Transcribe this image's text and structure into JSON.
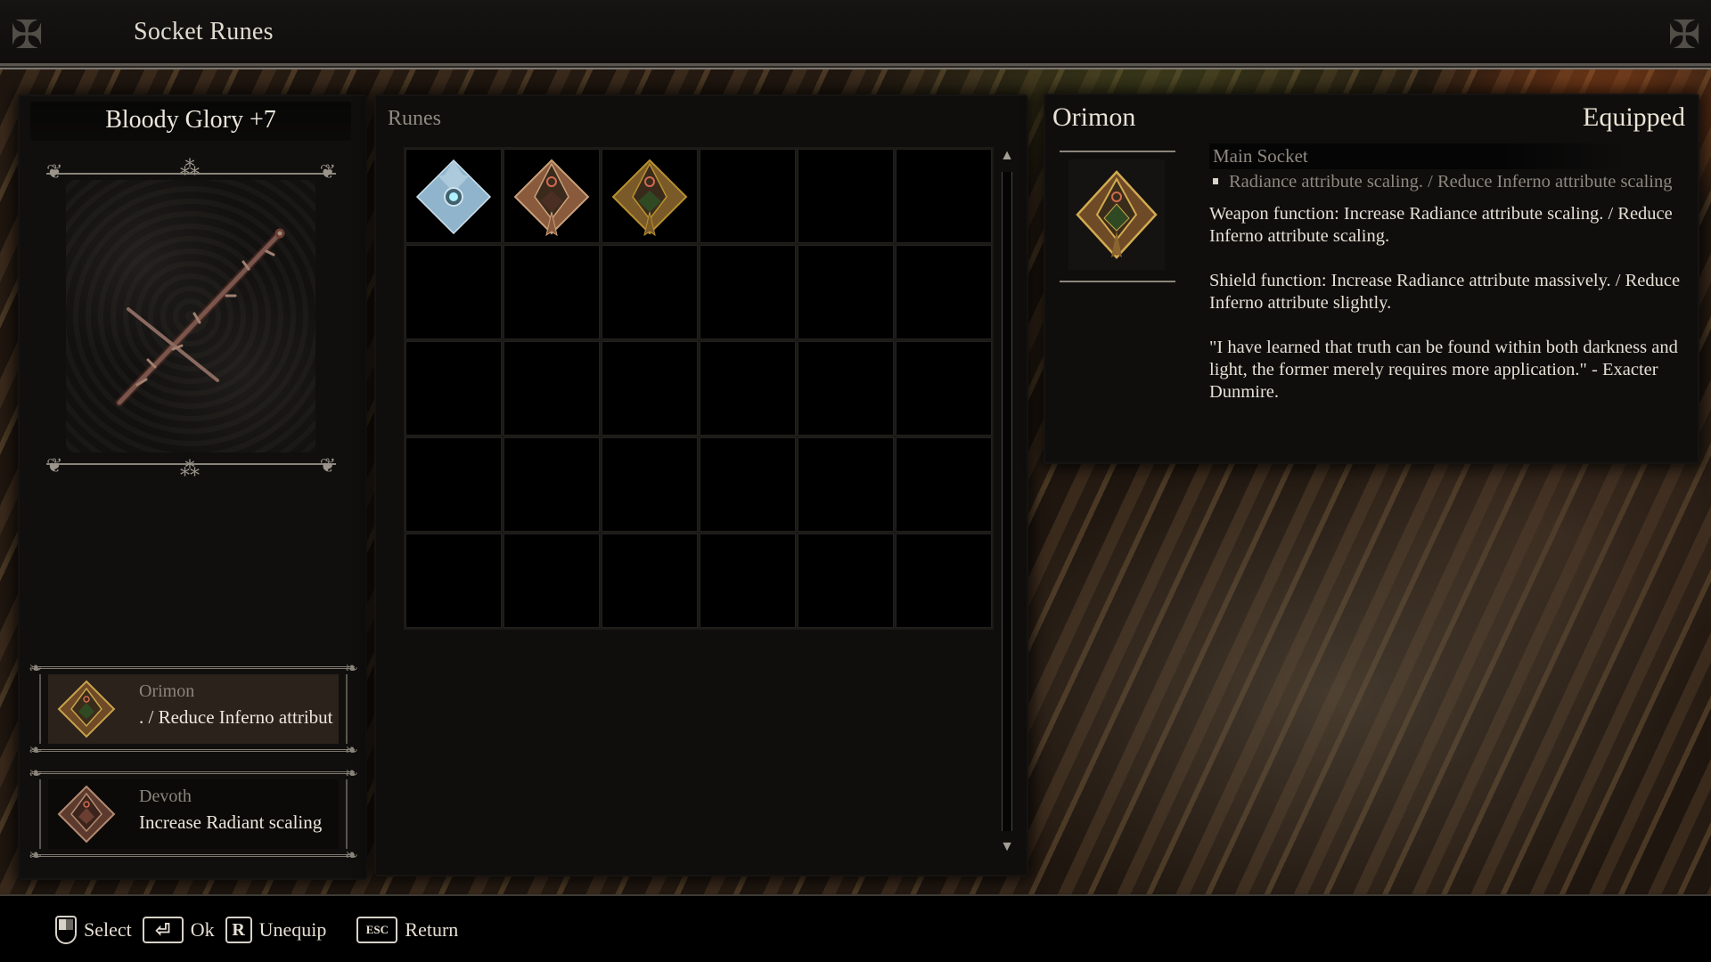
{
  "header": {
    "title": "Socket Runes"
  },
  "weapon": {
    "name": "Bloody Glory +7"
  },
  "sockets": [
    {
      "name": "Orimon",
      "description": ". / Reduce Inferno attribut",
      "selected": true,
      "rune_style": "gold-green"
    },
    {
      "name": "Devoth",
      "description": "Increase Radiant scaling",
      "selected": false,
      "rune_style": "bronze"
    }
  ],
  "runes_panel": {
    "label": "Runes",
    "columns": 6,
    "rows": 5,
    "items": [
      {
        "slot": 0,
        "style": "ice-blue"
      },
      {
        "slot": 1,
        "style": "bronze"
      },
      {
        "slot": 2,
        "style": "gold-green"
      }
    ]
  },
  "details": {
    "name": "Orimon",
    "status": "Equipped",
    "socket_type": "Main Socket",
    "effect": "Radiance attribute scaling. / Reduce Inferno attribute scaling",
    "paragraphs": [
      "Weapon function: Increase Radiance attribute scaling. / Reduce Inferno attribute scaling.",
      "Shield function: Increase Radiance attribute massively. / Reduce Inferno attribute slightly.",
      " \"I have learned that truth can be found within both darkness and light, the former merely requires more application.\" - Exacter Dunmire."
    ]
  },
  "footer": {
    "hints": [
      {
        "key": "mouse-left",
        "label": "Select"
      },
      {
        "key": "enter",
        "label": "Ok"
      },
      {
        "key": "R",
        "label": "Unequip"
      },
      {
        "key": "ESC",
        "label": "Return"
      }
    ]
  },
  "colors": {
    "text_primary": "#e6dfd4",
    "text_muted": "#8e887e",
    "panel_bg": "#0f0e0d",
    "selected_slot_bg": "#2a221b",
    "rune_ice": "#8fb4cc",
    "rune_bronze": "#8a5a3c",
    "rune_gold": "#b8902f"
  }
}
